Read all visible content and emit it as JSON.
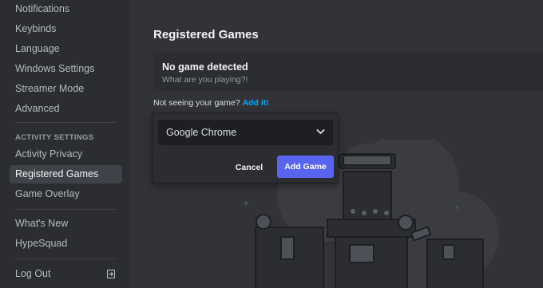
{
  "sidebar": {
    "items_top": [
      {
        "label": "Notifications"
      },
      {
        "label": "Keybinds"
      },
      {
        "label": "Language"
      },
      {
        "label": "Windows Settings"
      },
      {
        "label": "Streamer Mode"
      },
      {
        "label": "Advanced"
      }
    ],
    "activity_header": "ACTIVITY SETTINGS",
    "activity_items": [
      {
        "label": "Activity Privacy"
      },
      {
        "label": "Registered Games"
      },
      {
        "label": "Game Overlay"
      }
    ],
    "misc_items": [
      {
        "label": "What's New"
      },
      {
        "label": "HypeSquad"
      }
    ],
    "logout_label": "Log Out",
    "active_item": "Registered Games"
  },
  "main": {
    "title": "Registered Games",
    "status": {
      "title": "No game detected",
      "subtitle": "What are you playing?!"
    },
    "hint_text": "Not seeing your game?",
    "hint_link": "Add it!"
  },
  "popup": {
    "selected_game": "Google Chrome",
    "cancel_label": "Cancel",
    "add_label": "Add Game"
  },
  "colors": {
    "accent": "#5865f2",
    "link": "#00a8fc",
    "sidebar_bg": "#2b2d31",
    "main_bg": "#313338"
  }
}
